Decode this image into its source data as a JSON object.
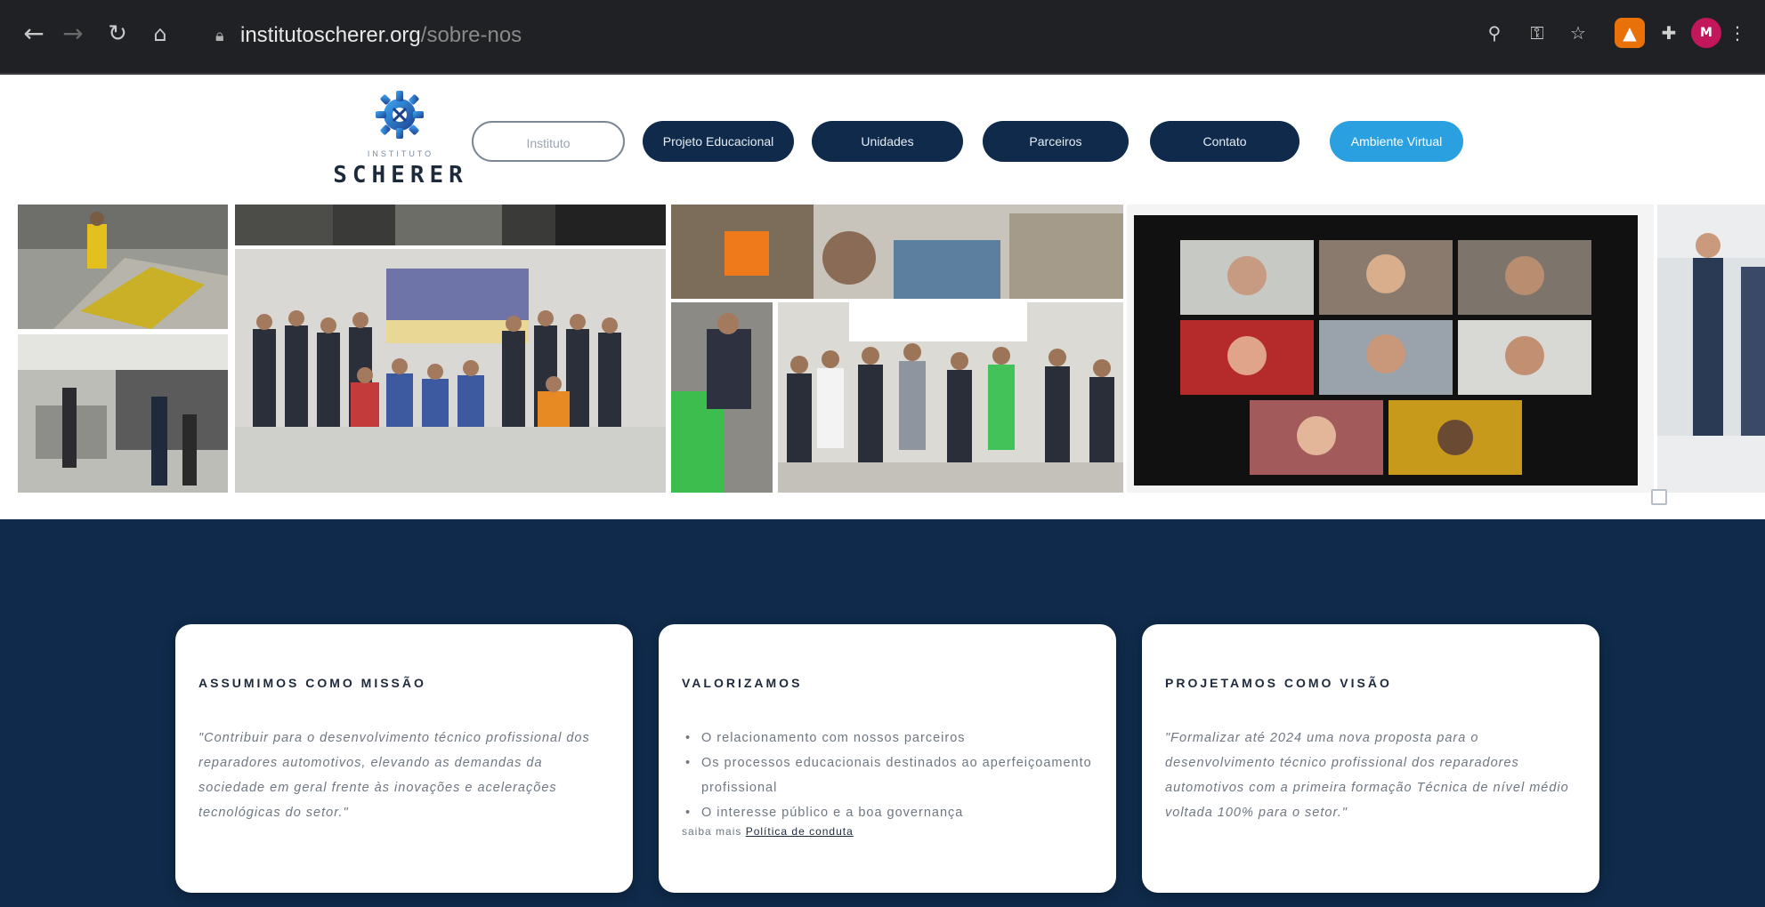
{
  "browser": {
    "url_host": "institutoscherer.org",
    "url_path": "/sobre-nos"
  },
  "site": {
    "logo_small": "INSTITUTO",
    "logo_name": "SCHERER"
  },
  "nav": {
    "items": [
      {
        "label": "Instituto",
        "style": "outline"
      },
      {
        "label": "Projeto Educacional",
        "style": "dark"
      },
      {
        "label": "Unidades",
        "style": "dark"
      },
      {
        "label": "Parceiros",
        "style": "dark"
      },
      {
        "label": "Contato",
        "style": "dark"
      },
      {
        "label": "Ambiente Virtual",
        "style": "accent"
      }
    ]
  },
  "values": {
    "cards": [
      {
        "title": "ASSUMIMOS COMO MISSÃO",
        "body": "\"Contribuir para o desenvolvimento técnico profissional dos reparadores automotivos, elevando as demandas da sociedade em geral frente às inovações e acelerações tecnológicas do setor.\""
      },
      {
        "title": "VALORIZAMOS",
        "items": [
          "O relacionamento com nossos parceiros",
          "Os processos educacionais destinados ao aperfeiçoamento profissional",
          "O interesse público e a boa governança"
        ],
        "tail": "saiba mais",
        "tail_link": "Política de conduta"
      },
      {
        "title": "PROJETAMOS COMO VISÃO",
        "body": "\"Formalizar até 2024 uma nova proposta para o desenvolvimento técnico profissional dos reparadores automotivos com a primeira formação Técnica de nível médio voltada 100% para o setor.\""
      }
    ]
  },
  "colors": {
    "brand_dark": "#0f2a4a",
    "accent": "#2aa0e0",
    "chrome_bg": "#202124"
  },
  "icons": [
    "back-arrow-icon",
    "forward-arrow-icon",
    "reload-icon",
    "home-icon",
    "lock-icon",
    "search-icon",
    "key-icon",
    "star-icon",
    "puzzle-icon",
    "gear-logo-icon",
    "menu-dots-icon"
  ]
}
